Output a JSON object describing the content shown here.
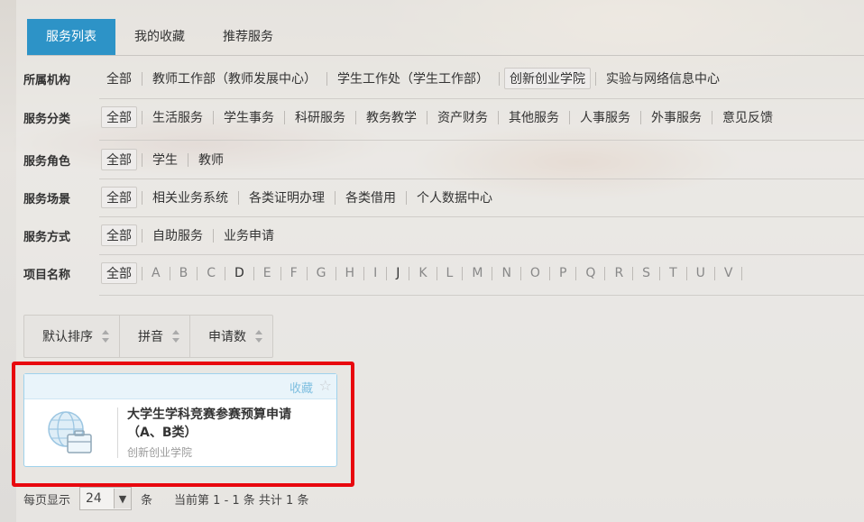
{
  "tabs": [
    {
      "label": "服务列表",
      "active": true
    },
    {
      "label": "我的收藏",
      "active": false
    },
    {
      "label": "推荐服务",
      "active": false
    }
  ],
  "filters": {
    "org": {
      "label": "所属机构",
      "options": [
        "全部",
        "教师工作部（教师发展中心）",
        "学生工作处（学生工作部）",
        "创新创业学院",
        "实验与网络信息中心"
      ],
      "selected": "创新创业学院"
    },
    "category": {
      "label": "服务分类",
      "options": [
        "全部",
        "生活服务",
        "学生事务",
        "科研服务",
        "教务教学",
        "资产财务",
        "其他服务",
        "人事服务",
        "外事服务",
        "意见反馈"
      ],
      "selected": "全部"
    },
    "role": {
      "label": "服务角色",
      "options": [
        "全部",
        "学生",
        "教师"
      ],
      "selected": "全部"
    },
    "scene": {
      "label": "服务场景",
      "options": [
        "全部",
        "相关业务系统",
        "各类证明办理",
        "各类借用",
        "个人数据中心"
      ],
      "selected": "全部"
    },
    "method": {
      "label": "服务方式",
      "options": [
        "全部",
        "自助服务",
        "业务申请"
      ],
      "selected": "全部"
    },
    "name": {
      "label": "项目名称",
      "all": "全部",
      "letters": [
        "A",
        "B",
        "C",
        "D",
        "E",
        "F",
        "G",
        "H",
        "I",
        "J",
        "K",
        "L",
        "M",
        "N",
        "O",
        "P",
        "Q",
        "R",
        "S",
        "T",
        "U",
        "V"
      ]
    }
  },
  "sort": {
    "default": "默认排序",
    "pinyin": "拼音",
    "count": "申请数"
  },
  "card": {
    "fav_label": "收藏",
    "title": "大学生学科竞赛参赛预算申请（A、B类）",
    "org": "创新创业学院",
    "icon": "globe-briefcase-icon"
  },
  "pager": {
    "per_page_label": "每页显示",
    "per_page_value": "24",
    "unit": "条",
    "status": "当前第 1 - 1 条 共计 1 条"
  },
  "colors": {
    "accent": "#2d93c7",
    "highlight": "#e8080e"
  }
}
